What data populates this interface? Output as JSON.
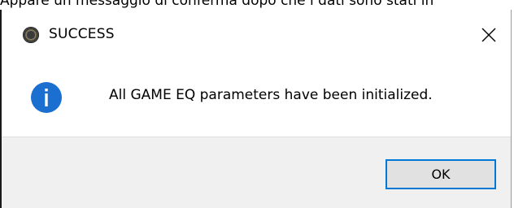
{
  "caption": "Appare un messaggio di conferma dopo che i dati sono stati in",
  "dialog": {
    "title": "SUCCESS",
    "app_icon": "app-logo-icon",
    "close_icon": "close-icon",
    "info_icon": "info-icon",
    "message": "All GAME EQ parameters have been initialized.",
    "ok_label": "OK",
    "accent_color": "#0078d7",
    "info_icon_color": "#1b6fd1"
  }
}
